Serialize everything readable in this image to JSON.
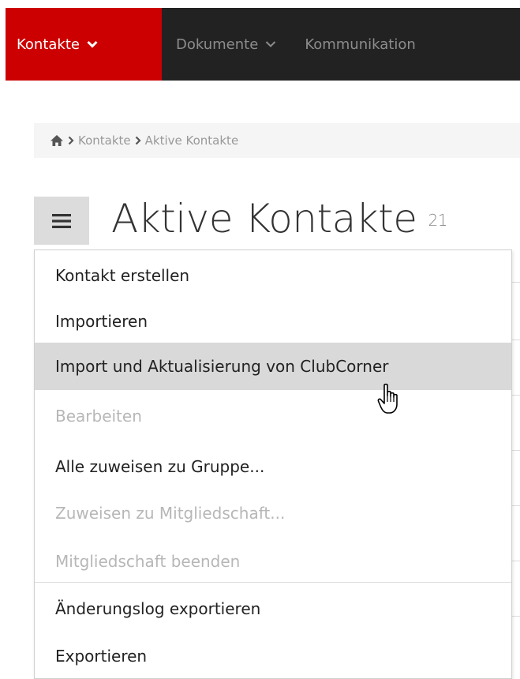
{
  "nav": {
    "items": [
      {
        "label": "Kontakte",
        "active": true
      },
      {
        "label": "Dokumente",
        "active": false
      },
      {
        "label": "Kommunikation",
        "active": false
      }
    ],
    "active_color": "#cc0000",
    "bar_color": "#222222"
  },
  "breadcrumb": {
    "home_icon": "home-icon",
    "items": [
      "Kontakte",
      "Aktive Kontakte"
    ]
  },
  "page": {
    "title": "Aktive Kontakte",
    "count": "21",
    "menu_icon": "hamburger-icon"
  },
  "dropdown": {
    "items": [
      {
        "label": "Kontakt erstellen",
        "disabled": false
      },
      {
        "label": "Importieren",
        "disabled": false
      },
      {
        "label": "Import und Aktualisierung von ClubCorner",
        "disabled": false,
        "hovered": true
      },
      {
        "label": "Bearbeiten",
        "disabled": true
      },
      {
        "label": "Alle zuweisen zu Gruppe...",
        "disabled": false
      },
      {
        "label": "Zuweisen zu Mitgliedschaft...",
        "disabled": true
      },
      {
        "label": "Mitgliedschaft beenden",
        "disabled": true
      },
      {
        "label": "Änderungslog exportieren",
        "disabled": false
      },
      {
        "label": "Exportieren",
        "disabled": false
      }
    ]
  },
  "cursor": {
    "icon": "hand-pointer-icon"
  }
}
